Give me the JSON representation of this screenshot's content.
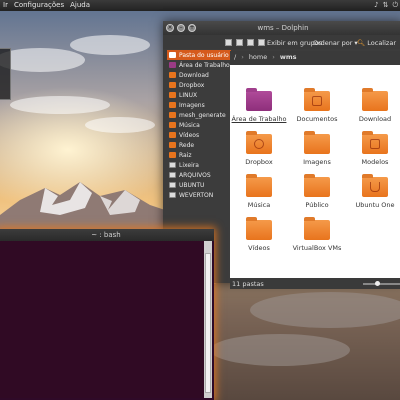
{
  "topbar": {
    "menu": [
      "Ir",
      "Configurações",
      "Ajuda"
    ],
    "tray_icons": [
      "volume-icon",
      "network-icon",
      "power-icon"
    ]
  },
  "dolphin": {
    "title": "wms – Dolphin",
    "toolbar": {
      "group_label": "Exibir em grupos",
      "sort_label": "Ordenar por",
      "locate_label": "Localizar"
    },
    "sidebar": [
      {
        "label": "Pasta do usuário",
        "icon": "home-icon",
        "active": true
      },
      {
        "label": "Área de Trabalho",
        "icon": "desktop-icon",
        "color": "#9b3b86"
      },
      {
        "label": "Download",
        "icon": "folder-icon",
        "color": "#e8741d"
      },
      {
        "label": "Dropbox",
        "icon": "folder-icon",
        "color": "#e8741d"
      },
      {
        "label": "LINUX",
        "icon": "folder-icon",
        "color": "#e8741d"
      },
      {
        "label": "Imagens",
        "icon": "folder-icon",
        "color": "#e8741d"
      },
      {
        "label": "mesh_generate",
        "icon": "folder-icon",
        "color": "#e8741d"
      },
      {
        "label": "Música",
        "icon": "folder-icon",
        "color": "#e8741d"
      },
      {
        "label": "Vídeos",
        "icon": "folder-icon",
        "color": "#e8741d"
      },
      {
        "label": "Rede",
        "icon": "folder-icon",
        "color": "#e8741d"
      },
      {
        "label": "Raiz",
        "icon": "folder-icon",
        "color": "#e8741d"
      },
      {
        "label": "Lixeira",
        "icon": "trash-icon",
        "color": "#dddddd"
      },
      {
        "label": "ARQUIVOS",
        "icon": "drive-icon",
        "color": "#dddddd"
      },
      {
        "label": "UBUNTU",
        "icon": "drive-icon",
        "color": "#dddddd"
      },
      {
        "label": "WEVERTON",
        "icon": "drive-icon",
        "color": "#dddddd"
      }
    ],
    "breadcrumb": [
      "home",
      "wms"
    ],
    "files": [
      {
        "label": "Área de Trabalho",
        "color": "purple"
      },
      {
        "label": "Documentos",
        "color": "orange"
      },
      {
        "label": "Download",
        "color": "orange"
      },
      {
        "label": "Dropbox",
        "color": "orange"
      },
      {
        "label": "Imagens",
        "color": "orange"
      },
      {
        "label": "Modelos",
        "color": "orange"
      },
      {
        "label": "Música",
        "color": "orange"
      },
      {
        "label": "Público",
        "color": "orange"
      },
      {
        "label": "Ubuntu One",
        "color": "orange"
      },
      {
        "label": "Vídeos",
        "color": "orange"
      },
      {
        "label": "VirtualBox VMs",
        "color": "orange"
      }
    ],
    "status": "11 pastas"
  },
  "terminal": {
    "title": "~ : bash"
  },
  "colors": {
    "accent": "#d55a1c",
    "folder": "#e8741d",
    "terminal_bg": "#300a24"
  }
}
